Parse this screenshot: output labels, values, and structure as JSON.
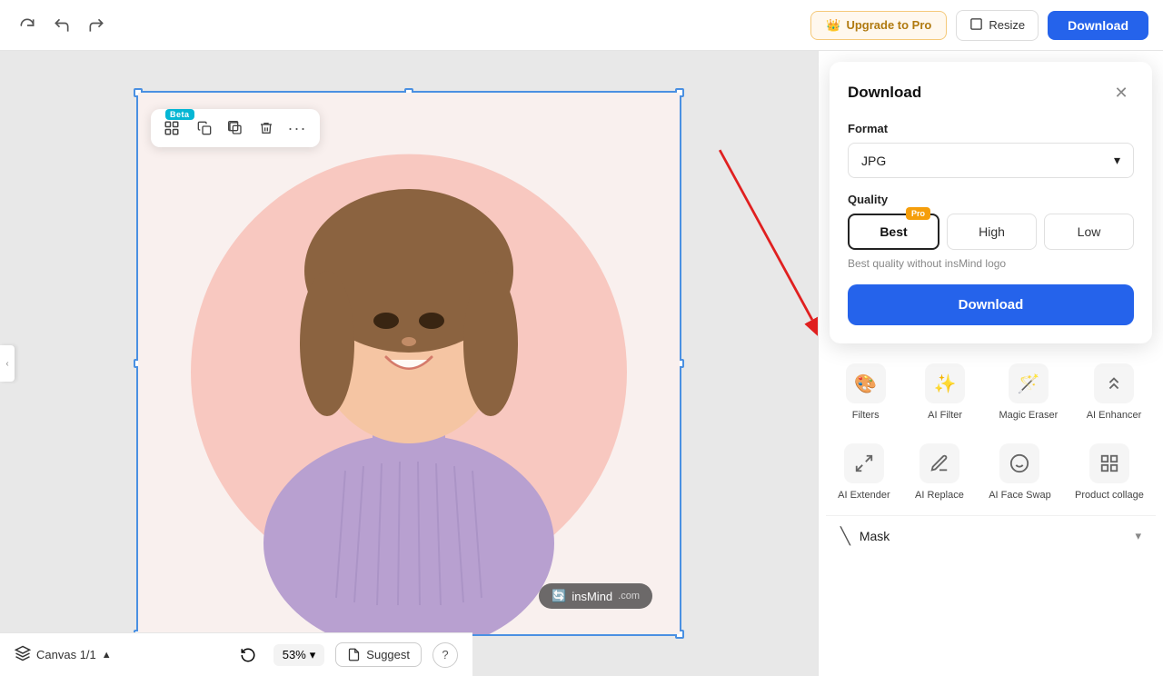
{
  "topbar": {
    "upgrade_label": "Upgrade to Pro",
    "resize_label": "Resize",
    "download_label": "Download"
  },
  "canvas": {
    "zoom": "53%",
    "canvas_label": "Canvas 1/1",
    "watermark": "🔄 insMind",
    "toolbar": {
      "badge": "Beta",
      "tooltip_ai": "AI",
      "tooltip_copy": "Copy",
      "tooltip_duplicate": "Duplicate",
      "tooltip_delete": "Delete",
      "tooltip_more": "More"
    }
  },
  "bottombar": {
    "zoom_label": "53%",
    "refresh_tooltip": "Reset",
    "suggest_label": "Suggest",
    "help_label": "?"
  },
  "download_panel": {
    "title": "Download",
    "format_label": "Format",
    "format_value": "JPG",
    "quality_label": "Quality",
    "quality_options": [
      {
        "id": "best",
        "label": "Best",
        "pro": true,
        "active": true
      },
      {
        "id": "high",
        "label": "High",
        "pro": false,
        "active": false
      },
      {
        "id": "low",
        "label": "Low",
        "pro": false,
        "active": false
      }
    ],
    "quality_note": "Best quality without insMind logo",
    "download_btn": "Download"
  },
  "tools": {
    "row1": [
      {
        "id": "filters",
        "icon": "🎨",
        "label": "Filters"
      },
      {
        "id": "ai-filter",
        "icon": "✨",
        "label": "AI Filter"
      },
      {
        "id": "magic-eraser",
        "icon": "🪄",
        "label": "Magic Eraser"
      },
      {
        "id": "ai-enhancer",
        "icon": "⬆️",
        "label": "AI Enhancer"
      }
    ],
    "row2": [
      {
        "id": "ai-extender",
        "icon": "⬛",
        "label": "AI Extender"
      },
      {
        "id": "ai-replace",
        "icon": "🖌️",
        "label": "AI Replace"
      },
      {
        "id": "ai-face-swap",
        "icon": "😊",
        "label": "AI Face Swap"
      },
      {
        "id": "product-collage",
        "icon": "📊",
        "label": "Product collage"
      }
    ]
  },
  "mask": {
    "label": "Mask",
    "icon": "╲"
  }
}
